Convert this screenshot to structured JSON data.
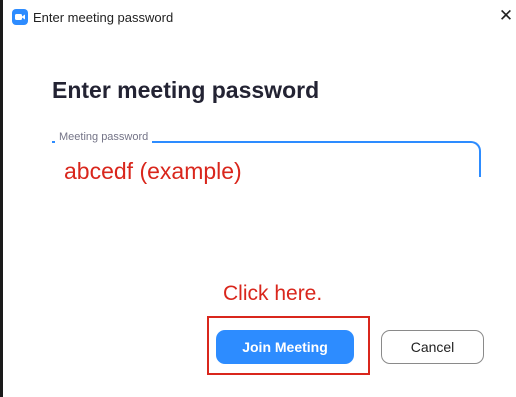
{
  "window": {
    "title": "Enter meeting password",
    "close_glyph": "✕",
    "app_icon": "zoom-camera-icon",
    "accent_color": "#2d8cff"
  },
  "dialog": {
    "heading": "Enter meeting password",
    "password_field": {
      "label": "Meeting password",
      "value": "abcedf (example)"
    },
    "join_button_label": "Join Meeting",
    "cancel_button_label": "Cancel"
  },
  "annotation": {
    "text": "Click here.",
    "color": "#d9261c"
  }
}
